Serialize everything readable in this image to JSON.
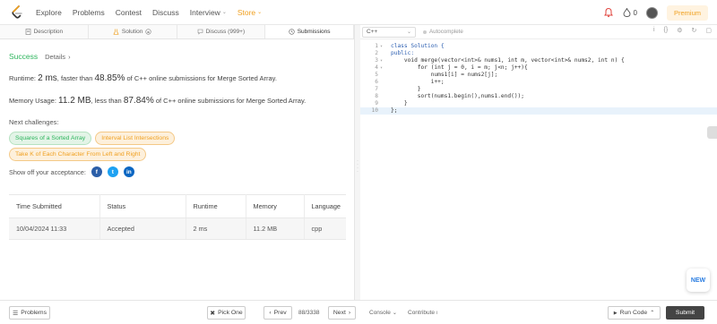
{
  "nav": {
    "items": [
      "Explore",
      "Problems",
      "Contest",
      "Discuss",
      "Interview",
      "Store"
    ],
    "fire_count": "0",
    "premium": "Premium"
  },
  "tabs": [
    "Description",
    "Solution",
    "Discuss (999+)",
    "Submissions"
  ],
  "result": {
    "status": "Success",
    "details": "Details",
    "runtime_prefix": "Runtime: ",
    "runtime_value": "2 ms",
    "runtime_mid": ", faster than ",
    "runtime_pct": "48.85%",
    "runtime_suffix": " of C++ online submissions for Merge Sorted Array.",
    "memory_prefix": "Memory Usage: ",
    "memory_value": "11.2 MB",
    "memory_mid": ", less than ",
    "memory_pct": "87.84%",
    "memory_suffix": " of C++ online submissions for Merge Sorted Array.",
    "next_label": "Next challenges:",
    "challenges": [
      {
        "label": "Squares of a Sorted Array",
        "difficulty": "easy"
      },
      {
        "label": "Interval List Intersections",
        "difficulty": "medium"
      },
      {
        "label": "Take K of Each Character From Left and Right",
        "difficulty": "medium"
      }
    ],
    "share_label": "Show off your acceptance:"
  },
  "submissions": {
    "headers": [
      "Time Submitted",
      "Status",
      "Runtime",
      "Memory",
      "Language"
    ],
    "rows": [
      [
        "10/04/2024 11:33",
        "Accepted",
        "2 ms",
        "11.2 MB",
        "cpp"
      ]
    ]
  },
  "editor": {
    "language": "C++",
    "autocomplete": "Autocomplete",
    "lines": [
      "class Solution {",
      "public:",
      "    void merge(vector<int>& nums1, int m, vector<int>& nums2, int n) {",
      "        for (int j = 0, i = m; j<n; j++){",
      "            nums1[i] = nums2[j];",
      "            i++;",
      "        }",
      "        sort(nums1.begin(),nums1.end());",
      "    }",
      "};"
    ],
    "line_numbers": [
      "1",
      "2",
      "3",
      "4",
      "5",
      "6",
      "7",
      "8",
      "9",
      "10"
    ]
  },
  "bottom": {
    "problems": "Problems",
    "pick_one": "Pick One",
    "prev": "Prev",
    "counter": "88/3338",
    "next": "Next",
    "console": "Console",
    "contribute": "Contribute",
    "run_code": "Run Code",
    "submit": "Submit"
  },
  "new_label": "NEW",
  "colors": {
    "success": "#2db55d",
    "medium": "#f0a020",
    "submit_bg": "#444444"
  }
}
